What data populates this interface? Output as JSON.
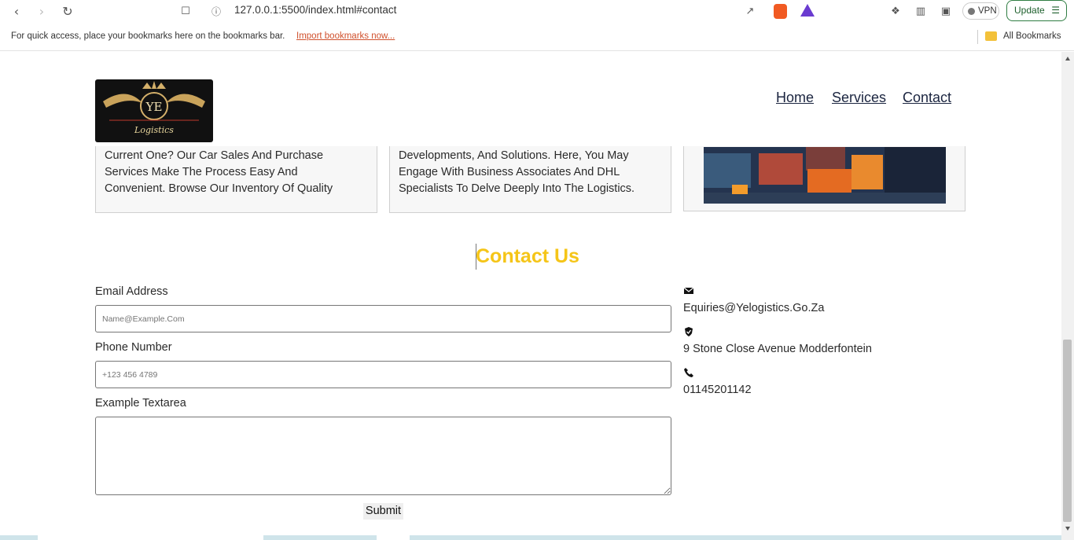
{
  "browser": {
    "url": "127.0.0.1:5500/index.html#contact",
    "bookmarks_prompt": "For quick access, place your bookmarks here on the bookmarks bar.",
    "import_link": "Import bookmarks now...",
    "all_bookmarks": "All Bookmarks",
    "vpn_label": "VPN",
    "update_label": "Update"
  },
  "header": {
    "logo_text": "YE",
    "logo_caption": "Logistics",
    "nav": [
      {
        "label": "Home"
      },
      {
        "label": "Services"
      },
      {
        "label": "Contact"
      }
    ]
  },
  "cards": [
    {
      "lines": [
        "Current One? Our Car Sales And Purchase",
        "Services Make The Process Easy And",
        "Convenient. Browse Our Inventory Of Quality"
      ]
    },
    {
      "lines": [
        "Developments, And Solutions. Here, You May",
        "Engage With Business Associates And DHL",
        "Specialists To Delve Deeply Into The Logistics."
      ]
    }
  ],
  "contact": {
    "title": "Contact Us",
    "email_label": "Email Address",
    "email_placeholder": "Name@Example.Com",
    "phone_label": "Phone Number",
    "phone_placeholder": "+123 456 4789",
    "textarea_label": "Example Textarea",
    "submit_label": "Submit",
    "info": {
      "email": "Equiries@Yelogistics.Go.Za",
      "address": "9 Stone Close Avenue Modderfontein",
      "phone": "01145201142"
    }
  },
  "colors": {
    "accent": "#f5c518",
    "nav": "#1b2540"
  }
}
